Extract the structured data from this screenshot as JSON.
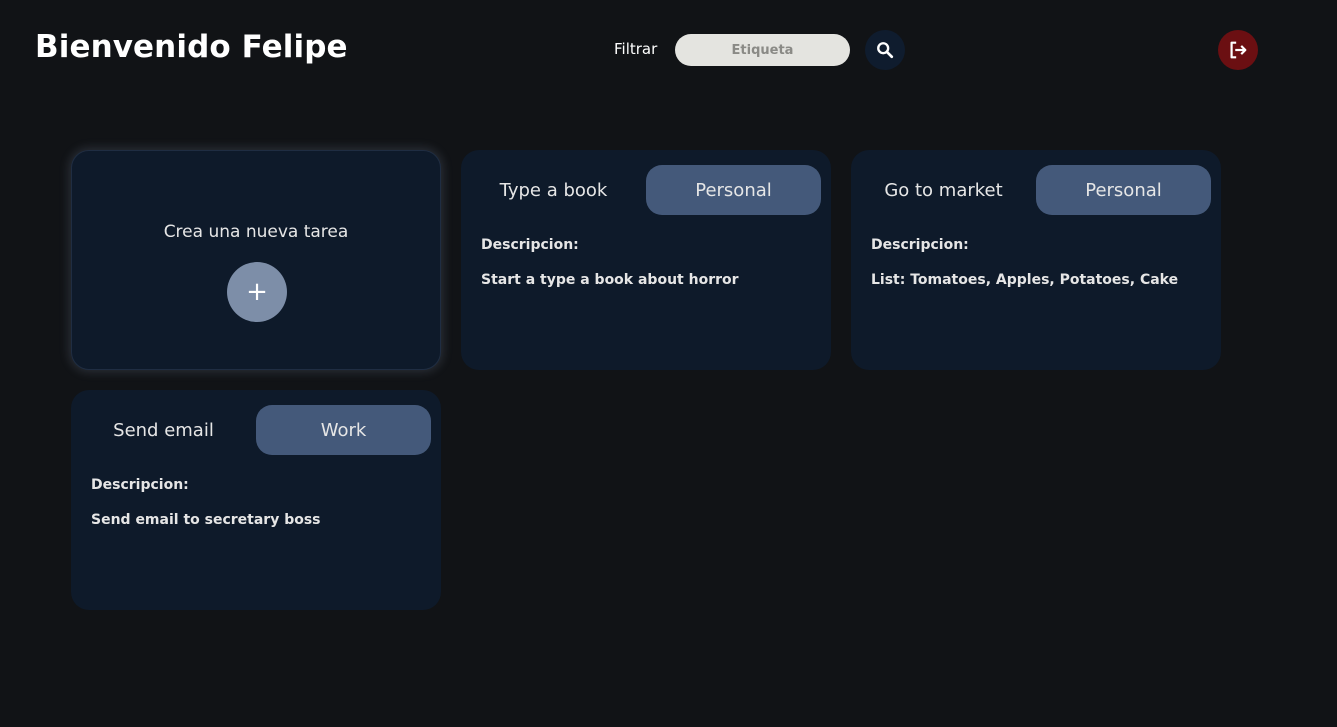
{
  "header": {
    "title": "Bienvenido Felipe",
    "filter_label": "Filtrar",
    "filter_placeholder": "Etiqueta",
    "search_icon": "search-icon",
    "logout_icon": "logout-icon"
  },
  "new_task": {
    "title": "Crea una nueva tarea",
    "add_label": "+"
  },
  "tasks": [
    {
      "name": "Type a book",
      "tag": "Personal",
      "description_label": "Descripcion:",
      "description": "Start a type a book about horror"
    },
    {
      "name": "Go to market",
      "tag": "Personal",
      "description_label": "Descripcion:",
      "description": "List: Tomatoes, Apples, Potatoes, Cake"
    },
    {
      "name": "Send email",
      "tag": "Work",
      "description_label": "Descripcion:",
      "description": "Send email to secretary boss"
    }
  ],
  "colors": {
    "background": "#111316",
    "card": "#0e1a2a",
    "tag": "#44597a",
    "add_button": "#7d8ea8",
    "search_button": "#0f1c2e",
    "logout_button": "#6b0f12"
  }
}
